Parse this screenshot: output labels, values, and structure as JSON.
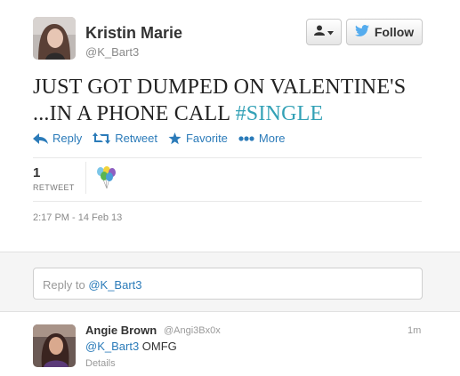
{
  "tweet": {
    "author": {
      "name": "Kristin Marie",
      "handle": "@K_Bart3"
    },
    "follow_label": "Follow",
    "text_line1": "JUST GOT DUMPED ON VALENTINE'S",
    "text_line2_prefix": "...IN A PHONE CALL",
    "hashtag": "#SINGLE",
    "actions": [
      {
        "label": "Reply",
        "icon": "reply-icon"
      },
      {
        "label": "Retweet",
        "icon": "retweet-icon"
      },
      {
        "label": "Favorite",
        "icon": "star-icon"
      },
      {
        "label": "More",
        "icon": "more-dots-icon"
      }
    ],
    "retweet_count": "1",
    "retweet_label": "RETWEET",
    "timestamp": "2:17 PM - 14 Feb 13"
  },
  "reply_box": {
    "prefix": "Reply to",
    "mention": "@K_Bart3"
  },
  "reply": {
    "name": "Angie Brown",
    "handle": "@Angi3Bx0x",
    "time": "1m",
    "mention": "@K_Bart3",
    "text": "OMFG",
    "details": "Details"
  },
  "colors": {
    "link": "#2b7bb9",
    "hashtag": "#33a1b6",
    "follow_bird": "#55acee"
  }
}
